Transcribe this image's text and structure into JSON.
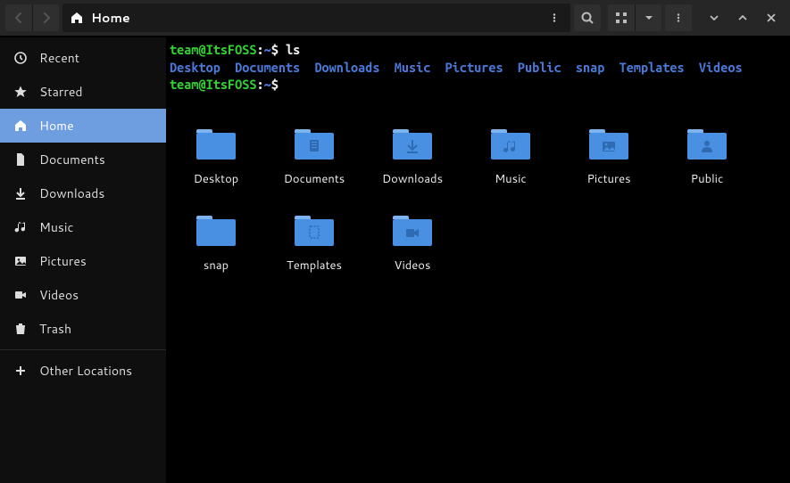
{
  "toolbar": {
    "location_label": "Home"
  },
  "sidebar": {
    "items": [
      {
        "label": "Recent",
        "icon": "clock",
        "active": false
      },
      {
        "label": "Starred",
        "icon": "star",
        "active": false
      },
      {
        "label": "Home",
        "icon": "home",
        "active": true
      },
      {
        "label": "Documents",
        "icon": "document",
        "active": false
      },
      {
        "label": "Downloads",
        "icon": "download",
        "active": false
      },
      {
        "label": "Music",
        "icon": "music",
        "active": false
      },
      {
        "label": "Pictures",
        "icon": "picture",
        "active": false
      },
      {
        "label": "Videos",
        "icon": "video",
        "active": false
      },
      {
        "label": "Trash",
        "icon": "trash",
        "active": false
      }
    ],
    "other_locations_label": "Other Locations"
  },
  "terminal": {
    "user": "team",
    "host": "ItsFOSS",
    "path": "~",
    "command": "ls",
    "output_dirs": [
      "Desktop",
      "Documents",
      "Downloads",
      "Music",
      "Pictures",
      "Public",
      "snap",
      "Templates",
      "Videos"
    ]
  },
  "folders": [
    {
      "label": "Desktop",
      "icon": "desktop"
    },
    {
      "label": "Documents",
      "icon": "document"
    },
    {
      "label": "Downloads",
      "icon": "download"
    },
    {
      "label": "Music",
      "icon": "music"
    },
    {
      "label": "Pictures",
      "icon": "picture"
    },
    {
      "label": "Public",
      "icon": "public"
    },
    {
      "label": "snap",
      "icon": "plain"
    },
    {
      "label": "Templates",
      "icon": "templates"
    },
    {
      "label": "Videos",
      "icon": "video"
    }
  ]
}
